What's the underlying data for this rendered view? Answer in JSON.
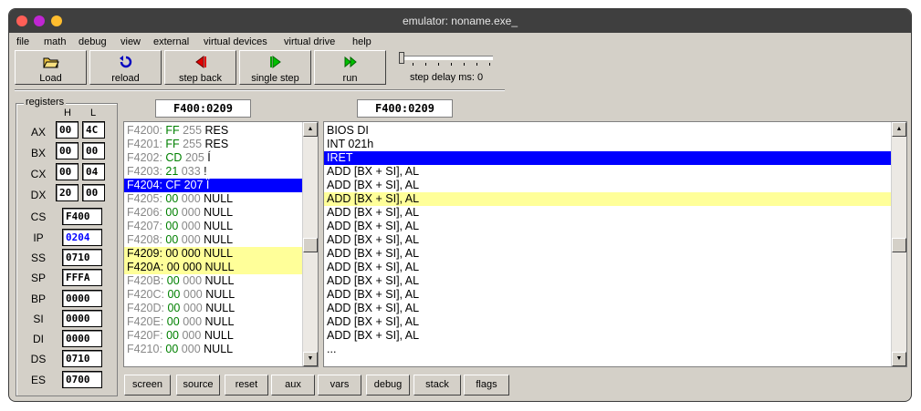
{
  "window": {
    "title": "emulator: noname.exe_",
    "traffic_colors": {
      "close": "#ff5f57",
      "minimize": "#c026d3",
      "zoom": "#ffbd2e"
    }
  },
  "menu": [
    "file",
    "math",
    "debug",
    "view",
    "external",
    "virtual devices",
    "virtual drive",
    "help"
  ],
  "toolbar": {
    "load": "Load",
    "reload": "reload",
    "step_back": "step back",
    "single_step": "single step",
    "run": "run",
    "step_delay": "step delay ms: 0"
  },
  "registers": {
    "group_label": "registers",
    "h_label": "H",
    "l_label": "L",
    "general": [
      {
        "name": "AX",
        "h": "00",
        "l": "4C"
      },
      {
        "name": "BX",
        "h": "00",
        "l": "00"
      },
      {
        "name": "CX",
        "h": "00",
        "l": "04"
      },
      {
        "name": "DX",
        "h": "20",
        "l": "00"
      }
    ],
    "segment": [
      {
        "name": "CS",
        "value": "F400"
      },
      {
        "name": "IP",
        "value": "0204"
      },
      {
        "name": "SS",
        "value": "0710"
      },
      {
        "name": "SP",
        "value": "FFFA"
      },
      {
        "name": "BP",
        "value": "0000"
      },
      {
        "name": "SI",
        "value": "0000"
      },
      {
        "name": "DI",
        "value": "0000"
      },
      {
        "name": "DS",
        "value": "0710"
      },
      {
        "name": "ES",
        "value": "0700"
      }
    ]
  },
  "memory": {
    "address": "F400:0209",
    "rows": [
      {
        "addr": "F4200:",
        "hex": "FF",
        "dec": "255",
        "chr": "RES"
      },
      {
        "addr": "F4201:",
        "hex": "FF",
        "dec": "255",
        "chr": "RES"
      },
      {
        "addr": "F4202:",
        "hex": "CD",
        "dec": "205",
        "chr": "Í"
      },
      {
        "addr": "F4203:",
        "hex": "21",
        "dec": "033",
        "chr": "!"
      },
      {
        "addr": "F4204:",
        "hex": "CF",
        "dec": "207",
        "chr": "Ï"
      },
      {
        "addr": "F4205:",
        "hex": "00",
        "dec": "000",
        "chr": "NULL"
      },
      {
        "addr": "F4206:",
        "hex": "00",
        "dec": "000",
        "chr": "NULL"
      },
      {
        "addr": "F4207:",
        "hex": "00",
        "dec": "000",
        "chr": "NULL"
      },
      {
        "addr": "F4208:",
        "hex": "00",
        "dec": "000",
        "chr": "NULL"
      },
      {
        "addr": "F4209:",
        "hex": "00",
        "dec": "000",
        "chr": "NULL"
      },
      {
        "addr": "F420A:",
        "hex": "00",
        "dec": "000",
        "chr": "NULL"
      },
      {
        "addr": "F420B:",
        "hex": "00",
        "dec": "000",
        "chr": "NULL"
      },
      {
        "addr": "F420C:",
        "hex": "00",
        "dec": "000",
        "chr": "NULL"
      },
      {
        "addr": "F420D:",
        "hex": "00",
        "dec": "000",
        "chr": "NULL"
      },
      {
        "addr": "F420E:",
        "hex": "00",
        "dec": "000",
        "chr": "NULL"
      },
      {
        "addr": "F420F:",
        "hex": "00",
        "dec": "000",
        "chr": "NULL"
      },
      {
        "addr": "F4210:",
        "hex": "00",
        "dec": "000",
        "chr": "NULL"
      }
    ]
  },
  "disassembly": {
    "address": "F400:0209",
    "lines": [
      "BIOS DI",
      "INT 021h",
      "IRET",
      "ADD [BX + SI], AL",
      "ADD [BX + SI], AL",
      "ADD [BX + SI], AL",
      "ADD [BX + SI], AL",
      "ADD [BX + SI], AL",
      "ADD [BX + SI], AL",
      "ADD [BX + SI], AL",
      "ADD [BX + SI], AL",
      "ADD [BX + SI], AL",
      "ADD [BX + SI], AL",
      "ADD [BX + SI], AL",
      "ADD [BX + SI], AL",
      "ADD [BX + SI], AL",
      "..."
    ]
  },
  "bottom_buttons": [
    "screen",
    "source",
    "reset",
    "aux",
    "vars",
    "debug",
    "stack",
    "flags"
  ],
  "colors": {
    "current_highlight": "#0000ff",
    "selection_highlight": "#ffff99",
    "hex_value": "#008000",
    "ip_value": "#0000ff"
  }
}
